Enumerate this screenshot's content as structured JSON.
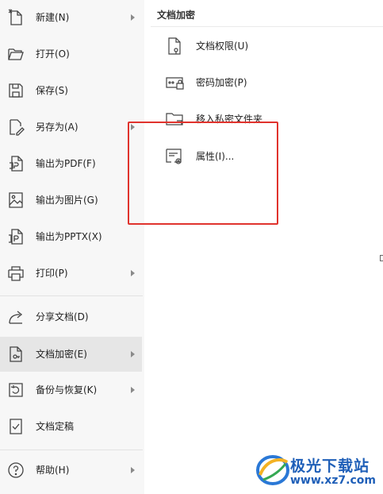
{
  "menu": {
    "items": [
      {
        "label": "新建(N)",
        "icon": "new-document-icon",
        "has_submenu": true
      },
      {
        "label": "打开(O)",
        "icon": "folder-open-icon",
        "has_submenu": false
      },
      {
        "label": "保存(S)",
        "icon": "save-icon",
        "has_submenu": false
      },
      {
        "label": "另存为(A)",
        "icon": "save-as-icon",
        "has_submenu": true
      },
      {
        "label": "输出为PDF(F)",
        "icon": "export-pdf-icon",
        "has_submenu": false
      },
      {
        "label": "输出为图片(G)",
        "icon": "export-image-icon",
        "has_submenu": false
      },
      {
        "label": "输出为PPTX(X)",
        "icon": "export-pptx-icon",
        "has_submenu": false
      },
      {
        "label": "打印(P)",
        "icon": "printer-icon",
        "has_submenu": true
      },
      {
        "label": "分享文档(D)",
        "icon": "share-icon",
        "has_submenu": false
      },
      {
        "label": "文档加密(E)",
        "icon": "document-encrypt-icon",
        "has_submenu": true,
        "active": true
      },
      {
        "label": "备份与恢复(K)",
        "icon": "backup-restore-icon",
        "has_submenu": true
      },
      {
        "label": "文档定稿",
        "icon": "document-finalize-icon",
        "has_submenu": false
      },
      {
        "label": "帮助(H)",
        "icon": "help-icon",
        "has_submenu": true
      }
    ]
  },
  "submenu": {
    "title": "文档加密",
    "items": [
      {
        "label": "文档权限(U)",
        "icon": "document-permission-icon"
      },
      {
        "label": "密码加密(P)",
        "icon": "password-lock-icon"
      },
      {
        "label": "移入私密文件夹",
        "icon": "private-folder-icon"
      },
      {
        "label": "属性(I)...",
        "icon": "properties-icon"
      }
    ]
  },
  "watermark": {
    "brand": "极光下载站",
    "site": "www.xz7.com"
  },
  "colors": {
    "highlight": "#e0332d",
    "active_item": "#e6e6e6",
    "menu_bg": "#f7f7f7",
    "watermark": "#1f5fb8"
  }
}
